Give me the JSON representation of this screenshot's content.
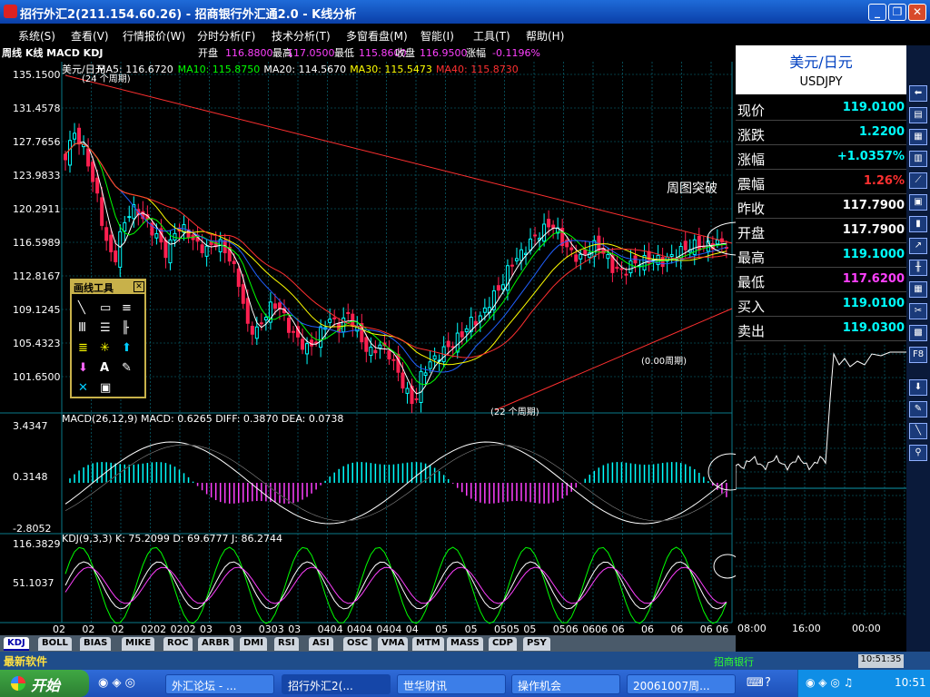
{
  "window": {
    "title": "招行外汇2(211.154.60.26) - 招商银行外汇通2.0 - K线分析",
    "buttons": {
      "minimize": "_",
      "restore": "❐",
      "close": "✕"
    }
  },
  "menu": [
    {
      "label": "系统(S)"
    },
    {
      "label": "查看(V)"
    },
    {
      "label": "行情报价(W)"
    },
    {
      "label": "分时分析(F)"
    },
    {
      "label": "技术分析(T)"
    },
    {
      "label": "多窗看盘(M)"
    },
    {
      "label": "智能(I)"
    },
    {
      "label": "工具(T)"
    },
    {
      "label": "帮助(H)"
    }
  ],
  "chart_header": {
    "mode": "周线 K线 MACD KDJ",
    "open_label": "开盘",
    "open": "116.8800",
    "high_label": "最高",
    "high": "117.0500",
    "low_label": "最低",
    "low": "115.8600",
    "close_label": "收盘",
    "close": "116.9500",
    "chg_label": "涨幅",
    "chg": "-0.1196%"
  },
  "ma_legend": [
    {
      "label": "美元/日元",
      "color": "#ffffff"
    },
    {
      "label": "MA5: 116.6720",
      "color": "#ffffff"
    },
    {
      "label": "MA10: 115.8750",
      "color": "#00ff00"
    },
    {
      "label": "MA20: 114.5670",
      "color": "#ffffff"
    },
    {
      "label": "MA30: 115.5473",
      "color": "#ffff00"
    },
    {
      "label": "MA40: 115.8730",
      "color": "#ff3030"
    }
  ],
  "price_axis": [
    "135.1500",
    "131.4578",
    "127.7656",
    "123.9833",
    "120.2911",
    "116.5989",
    "112.8167",
    "109.1245",
    "105.4323",
    "101.6500"
  ],
  "macd": {
    "title": "MACD(26,12,9) MACD: 0.6265  DIFF: 0.3870  DEA: 0.0738",
    "axis": [
      "3.4347",
      "0.3148",
      "-2.8052"
    ]
  },
  "kdj": {
    "title": "KDJ(9,3,3) K: 75.2099  D: 69.6777  J: 86.2744",
    "axis": [
      "116.3829",
      "51.1037"
    ]
  },
  "time_axis": [
    "02",
    "02",
    "02",
    "0202",
    "0202",
    "03",
    "03",
    "0303",
    "03",
    "0404",
    "0404",
    "0404",
    "04",
    "05",
    "05",
    "0505",
    "05",
    "0506",
    "0606",
    "06",
    "06",
    "06",
    "06 06"
  ],
  "annotations": {
    "breakout": "周图突破",
    "period1": "(24 个周期)",
    "period2": "(0.00周期)",
    "period3": "(22 个周期)"
  },
  "draw_tool": {
    "title": "画线工具"
  },
  "quote": {
    "name": "美元/日元",
    "code": "USDJPY",
    "rows": [
      {
        "label": "现价",
        "value": "119.0100",
        "color": "#00ffff"
      },
      {
        "label": "涨跌",
        "value": "1.2200",
        "color": "#00ffff"
      },
      {
        "label": "涨幅",
        "value": "+1.0357%",
        "color": "#00ffff"
      },
      {
        "label": "震幅",
        "value": "1.26%",
        "color": "#ff3030"
      },
      {
        "label": "昨收",
        "value": "117.7900",
        "color": "#ffffff"
      },
      {
        "label": "开盘",
        "value": "117.7900",
        "color": "#ffffff"
      },
      {
        "label": "最高",
        "value": "119.1000",
        "color": "#00ffff"
      },
      {
        "label": "最低",
        "value": "117.6200",
        "color": "#ff40ff"
      },
      {
        "label": "买入",
        "value": "119.0100",
        "color": "#00ffff"
      },
      {
        "label": "卖出",
        "value": "119.0300",
        "color": "#00ffff"
      }
    ]
  },
  "intraday_axis": [
    "08:00",
    "16:00",
    "00:00"
  ],
  "tabs": [
    "KDJ",
    "BOLL",
    "BIAS",
    "MIKE",
    "ROC",
    "ARBR",
    "DMI",
    "RSI",
    "ASI",
    "OSC",
    "VMA",
    "MTM",
    "MASS",
    "CDP",
    "PSY"
  ],
  "status": {
    "left": "最新软件",
    "right": "招商银行",
    "time": "10:51:35"
  },
  "taskbar": {
    "start": "开始",
    "tasks": [
      {
        "label": "外汇论坛 - ..."
      },
      {
        "label": "招行外汇2(..."
      },
      {
        "label": "世华财讯"
      },
      {
        "label": "操作机会"
      },
      {
        "label": "20061007周..."
      }
    ],
    "clock": "10:51"
  },
  "colors": {
    "candle_up": "#00ffff",
    "candle_down": "#ff2050",
    "ma5": "#ffffff",
    "ma10": "#00ff00",
    "ma20": "#ffffff",
    "ma30": "#ffff00",
    "ma40": "#ff3030",
    "grid": "#0a7a8a",
    "trendline": "#ff3030"
  }
}
